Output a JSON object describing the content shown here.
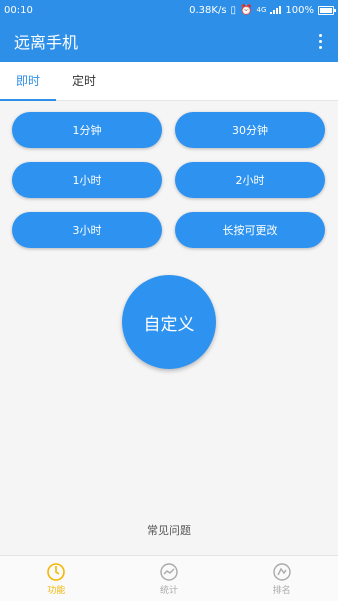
{
  "status": {
    "time": "00:10",
    "speed": "0.38K/s",
    "net_label": "4G",
    "battery": "100%"
  },
  "appbar": {
    "title": "远离手机"
  },
  "tabs": [
    {
      "label": "即时",
      "active": true
    },
    {
      "label": "定时",
      "active": false
    }
  ],
  "buttons": {
    "b1": "1分钟",
    "b2": "30分钟",
    "b3": "1小时",
    "b4": "2小时",
    "b5": "3小时",
    "b6": "长按可更改"
  },
  "custom_label": "自定义",
  "faq_label": "常见问题",
  "nav": [
    {
      "label": "功能",
      "icon": "function-icon",
      "active": true
    },
    {
      "label": "统计",
      "icon": "stats-icon",
      "active": false
    },
    {
      "label": "排名",
      "icon": "ranking-icon",
      "active": false
    }
  ],
  "colors": {
    "primary": "#2e8fe9",
    "button": "#2e93f0",
    "nav_active": "#f2b705"
  }
}
